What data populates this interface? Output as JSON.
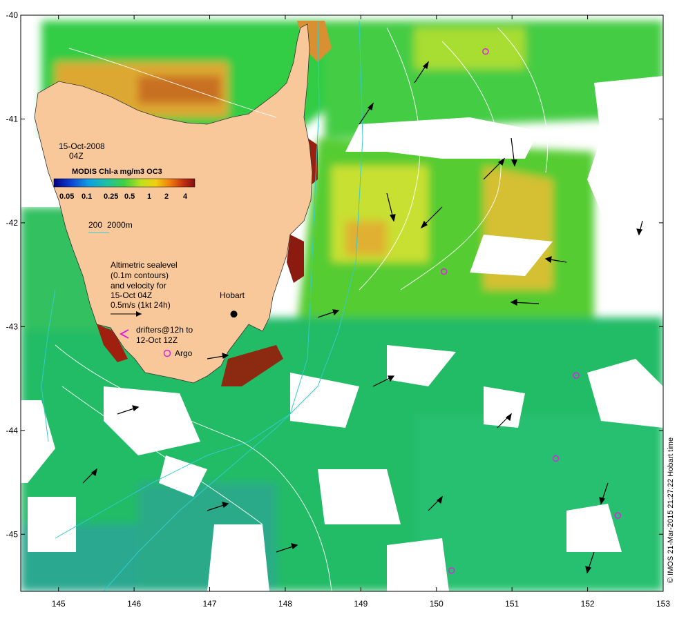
{
  "map": {
    "longitude_ticks": [
      "145",
      "146",
      "147",
      "148",
      "149",
      "150",
      "151",
      "152",
      "153"
    ],
    "latitude_ticks": [
      "-40",
      "-41",
      "-42",
      "-43",
      "-44",
      "-45"
    ],
    "lon_range": [
      144.5,
      153
    ],
    "lat_range": [
      -45.55,
      -40
    ]
  },
  "annotations": {
    "date": "15-Oct-2008",
    "time": "04Z",
    "colorbar_title": "MODIS Chl-a mg/m3 OC3",
    "colorbar_ticks": [
      "0.05",
      "0.1",
      "0.25",
      "0.5",
      "1",
      "2",
      "4"
    ],
    "bathy_200": "200",
    "bathy_2000": "2000m",
    "sealevel_lines": [
      "Altimetric sealevel",
      "(0.1m contours)",
      "and velocity for",
      "15-Oct 04Z",
      "0.5m/s (1kt 24h)"
    ],
    "drifters_lines": [
      "drifters@12h to",
      "12-Oct 12Z"
    ],
    "argo_label": "Argo",
    "city_label": "Hobart",
    "credit": "© IMOS 21-Mar-2015 21:27:22 Hobart time"
  },
  "colors": {
    "land": "#f8c89a",
    "chl_low": "#1a9e9e",
    "chl_mid": "#33cc33",
    "chl_high": "#e8a020",
    "chl_max": "#8b1a10",
    "argo": "#dd22dd",
    "bathy": "#33cccc"
  },
  "argo_floats": [
    {
      "lon": 150.65,
      "lat": -40.35
    },
    {
      "lon": 150.1,
      "lat": -42.47
    },
    {
      "lon": 151.85,
      "lat": -43.47
    },
    {
      "lon": 151.58,
      "lat": -44.27
    },
    {
      "lon": 152.4,
      "lat": -44.82
    },
    {
      "lon": 150.2,
      "lat": -45.35
    }
  ],
  "hobart": {
    "lon": 147.32,
    "lat": -42.88
  }
}
